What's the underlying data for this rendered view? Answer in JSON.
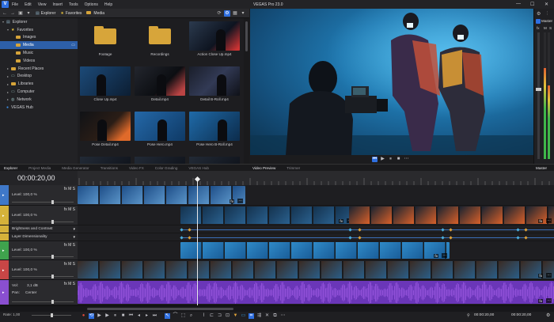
{
  "app": {
    "logo": "V",
    "title": "VEGAS Pro 23.0"
  },
  "menu": [
    "File",
    "Edit",
    "View",
    "Insert",
    "Tools",
    "Options",
    "Help"
  ],
  "window_controls": [
    "—",
    "☐",
    "✕"
  ],
  "explorer": {
    "crumbs": [
      "Explorer",
      "Favorites",
      "Media"
    ],
    "tree": [
      {
        "label": "Explorer",
        "indent": 0,
        "arrow": "▾"
      },
      {
        "label": "Favorites",
        "indent": 1,
        "arrow": "▾",
        "star": true
      },
      {
        "label": "Images",
        "indent": 2,
        "arrow": ""
      },
      {
        "label": "Media",
        "indent": 2,
        "arrow": "",
        "selected": true
      },
      {
        "label": "Music",
        "indent": 2,
        "arrow": ""
      },
      {
        "label": "Videos",
        "indent": 2,
        "arrow": ""
      },
      {
        "label": "Recent Places",
        "indent": 1,
        "arrow": "▸"
      },
      {
        "label": "Desktop",
        "indent": 1,
        "arrow": "▸"
      },
      {
        "label": "Libraries",
        "indent": 1,
        "arrow": "▸"
      },
      {
        "label": "Computer",
        "indent": 1,
        "arrow": "▸"
      },
      {
        "label": "Network",
        "indent": 1,
        "arrow": "▸"
      },
      {
        "label": "VEGAS Hub",
        "indent": 0,
        "arrow": ""
      }
    ],
    "media": [
      {
        "label": "Footage",
        "kind": "folder"
      },
      {
        "label": "Recordings",
        "kind": "folder"
      },
      {
        "label": "Action Close Up.mp4",
        "kind": "video"
      },
      {
        "label": "Close Up.mp4",
        "kind": "video"
      },
      {
        "label": "Detail.mp4",
        "kind": "video"
      },
      {
        "label": "Detail B-Roll.mp4",
        "kind": "video"
      },
      {
        "label": "Pose Detail.mp4",
        "kind": "video"
      },
      {
        "label": "Pose Hero.mp4",
        "kind": "video"
      },
      {
        "label": "Pose Hero B-Roll.mp4",
        "kind": "video"
      }
    ]
  },
  "preview": {
    "controls": [
      "⏮",
      "▶",
      "⏸",
      "■",
      "⋯"
    ]
  },
  "mixer": {
    "label": "Master",
    "meter_left": 0.72,
    "meter_right": 0.58
  },
  "tabs_left": [
    "Explorer",
    "Project Media",
    "Media Generator",
    "Transitions",
    "Video FX",
    "Color Grading",
    "VEGAS Hub"
  ],
  "tabs_right": [
    "Video Preview",
    "Trimmer"
  ],
  "tab_mixer": "Master Bus",
  "timeline": {
    "timecode": "00:00:20,00",
    "tracks": [
      {
        "label": "Level: 100,0 %",
        "color": "#3f78c8"
      },
      {
        "label": "Level: 100,0 %",
        "color": "#d5b23a"
      },
      {
        "label": "Brightness and Contrast",
        "color": "#d5b23a",
        "sub": true
      },
      {
        "label": "Layer Dimensionality",
        "color": "#d5b23a",
        "sub": true
      },
      {
        "label": "Level: 100,0 %",
        "color": "#3fa34d"
      },
      {
        "label": "Level: 100,0 %",
        "color": "#c84646"
      },
      {
        "label": "Vol:",
        "value": "3,1 dB",
        "pan_label": "Pan:",
        "pan_value": "Center",
        "color": "#8a4fd0"
      }
    ],
    "track_icons": "fx M S",
    "clip_fx": "fx",
    "clip_more": "⋯"
  },
  "bottom": {
    "rate": "Rate: 1,00",
    "tc1": "00:00:20,00",
    "tc2": "00:00:20,00"
  }
}
